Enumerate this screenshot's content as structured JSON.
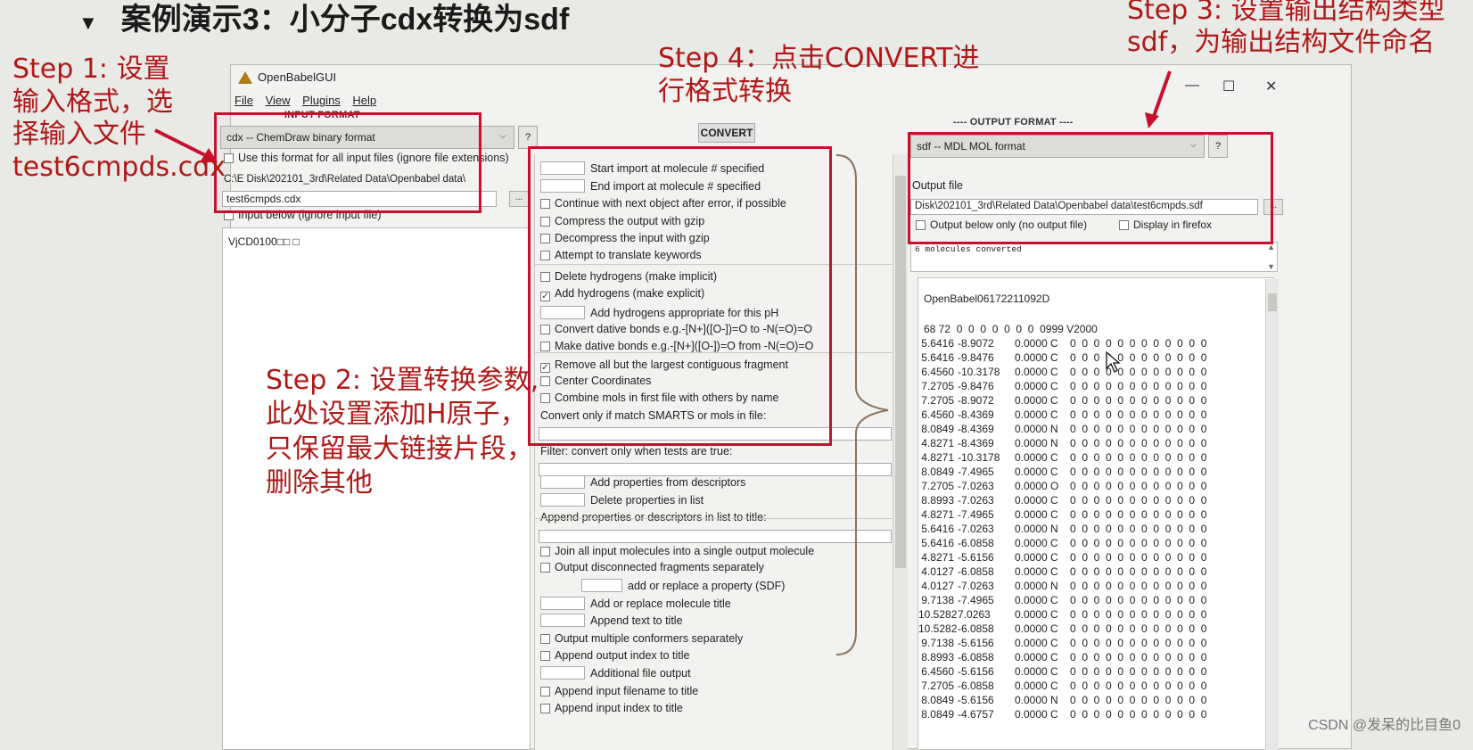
{
  "slide": {
    "bullet": "▼",
    "title": "案例演示3：小分子cdx转换为sdf",
    "step1": "Step 1: 设置输入格式，选择输入文件test6cmpds.cdx",
    "step2": "Step 2: 设置转换参数, 此处设置添加H原子，只保留最大链接片段，删除其他",
    "step3": "Step 3: 设置输出结构类型sdf，为输出结构文件命名",
    "step4": "Step 4：点击CONVERT进行格式转换",
    "watermark": "CSDN @发呆的比目鱼0",
    "annotation_color": "#c8102e"
  },
  "window": {
    "title": "OpenBabelGUI",
    "menu": [
      "File",
      "View",
      "Plugins",
      "Help"
    ],
    "controls": {
      "minimize": "—",
      "maximize": "☐",
      "close": "✕"
    }
  },
  "input": {
    "section_label": "INPUT FORMAT",
    "format": "cdx -- ChemDraw binary format",
    "help": "?",
    "use_for_all": "Use this format for all input files (ignore file extensions)",
    "folder": "C:\\E Disk\\202101_3rd\\Related Data\\Openbabel data\\",
    "file": "test6cmpds.cdx",
    "browse": "...",
    "input_below": "Input below (ignore input file)",
    "preview": "VjCD0100□□ □"
  },
  "convert_label": "CONVERT",
  "options": [
    {
      "type": "num",
      "label": "Start import at molecule # specified"
    },
    {
      "type": "num",
      "label": "End import at molecule # specified"
    },
    {
      "type": "check",
      "checked": false,
      "label": "Continue with next object after error, if possible"
    },
    {
      "type": "check",
      "checked": false,
      "label": "Compress the output with gzip"
    },
    {
      "type": "check",
      "checked": false,
      "label": "Decompress the input with gzip"
    },
    {
      "type": "check",
      "checked": false,
      "label": "Attempt to translate keywords"
    },
    {
      "type": "check",
      "checked": false,
      "label": "Delete hydrogens (make implicit)"
    },
    {
      "type": "check",
      "checked": true,
      "label": "Add hydrogens (make explicit)"
    },
    {
      "type": "num",
      "label": "Add hydrogens appropriate for this pH"
    },
    {
      "type": "check",
      "checked": false,
      "label": "Convert dative bonds e.g.-[N+]([O-])=O to -N(=O)=O"
    },
    {
      "type": "check",
      "checked": false,
      "label": "Make dative bonds e.g.-[N+]([O-])=O from -N(=O)=O"
    },
    {
      "type": "check",
      "checked": true,
      "label": "Remove all but the largest contiguous fragment"
    },
    {
      "type": "check",
      "checked": false,
      "label": "Center Coordinates"
    },
    {
      "type": "check",
      "checked": false,
      "label": "Combine mols in first file with others by name"
    },
    {
      "type": "label",
      "label": "Convert only if match SMARTS or mols in file:"
    },
    {
      "type": "field"
    },
    {
      "type": "label",
      "label": "Filter: convert only when tests are true:"
    },
    {
      "type": "field"
    },
    {
      "type": "num",
      "label": "Add properties from descriptors"
    },
    {
      "type": "num",
      "label": "Delete properties in list"
    },
    {
      "type": "label",
      "label": "Append properties or descriptors in list to title:"
    },
    {
      "type": "field"
    },
    {
      "type": "check",
      "checked": false,
      "label": "Join all input molecules into a single output molecule"
    },
    {
      "type": "check",
      "checked": false,
      "label": "Output disconnected fragments separately"
    },
    {
      "type": "num2",
      "label": "add or replace a property (SDF)"
    },
    {
      "type": "num",
      "label": "Add or replace molecule title"
    },
    {
      "type": "num",
      "label": "Append text to title"
    },
    {
      "type": "check",
      "checked": false,
      "label": "Output multiple conformers separately"
    },
    {
      "type": "check",
      "checked": false,
      "label": "Append output index to title"
    },
    {
      "type": "num",
      "label": "Additional file output"
    },
    {
      "type": "check",
      "checked": false,
      "label": "Append input filename to title"
    },
    {
      "type": "check",
      "checked": false,
      "label": "Append input index to title"
    }
  ],
  "output": {
    "section_label": "---- OUTPUT FORMAT ----",
    "format": "sdf -- MDL MOL format",
    "help": "?",
    "file_label": "Output file",
    "file": "Disk\\202101_3rd\\Related Data\\Openbabel data\\test6cmpds.sdf",
    "browse": "...",
    "below_only": "Output below only (no output file)",
    "display_firefox": "Display in firefox",
    "message": "6 molecules converted",
    "header": "OpenBabel06172211092D",
    "counts": "68 72  0  0  0  0  0  0  0  0999 V2000",
    "atoms": [
      [
        "5.6416",
        "-8.9072",
        "0.0000 C"
      ],
      [
        "5.6416",
        "-9.8476",
        "0.0000 C"
      ],
      [
        "6.4560",
        "-10.3178",
        "0.0000 C"
      ],
      [
        "7.2705",
        "-9.8476",
        "0.0000 C"
      ],
      [
        "7.2705",
        "-8.9072",
        "0.0000 C"
      ],
      [
        "6.4560",
        "-8.4369",
        "0.0000 C"
      ],
      [
        "8.0849",
        "-8.4369",
        "0.0000 N"
      ],
      [
        "4.8271",
        "-8.4369",
        "0.0000 N"
      ],
      [
        "4.8271",
        "-10.3178",
        "0.0000 C"
      ],
      [
        "8.0849",
        "-7.4965",
        "0.0000 C"
      ],
      [
        "7.2705",
        "-7.0263",
        "0.0000 O"
      ],
      [
        "8.8993",
        "-7.0263",
        "0.0000 C"
      ],
      [
        "4.8271",
        "-7.4965",
        "0.0000 C"
      ],
      [
        "5.6416",
        "-7.0263",
        "0.0000 N"
      ],
      [
        "5.6416",
        "-6.0858",
        "0.0000 C"
      ],
      [
        "4.8271",
        "-5.6156",
        "0.0000 C"
      ],
      [
        "4.0127",
        "-6.0858",
        "0.0000 C"
      ],
      [
        "4.0127",
        "-7.0263",
        "0.0000 N"
      ],
      [
        "9.7138",
        "-7.4965",
        "0.0000 C"
      ],
      [
        "10.5282",
        "7.0263",
        "0.0000 C"
      ],
      [
        "10.5282",
        "-6.0858",
        "0.0000 C"
      ],
      [
        "9.7138",
        "-5.6156",
        "0.0000 C"
      ],
      [
        "8.8993",
        "-6.0858",
        "0.0000 C"
      ],
      [
        "6.4560",
        "-5.6156",
        "0.0000 C"
      ],
      [
        "7.2705",
        "-6.0858",
        "0.0000 C"
      ],
      [
        "8.0849",
        "-5.6156",
        "0.0000 N"
      ],
      [
        "8.0849",
        "-4.6757",
        "0.0000 C"
      ]
    ],
    "flags": "0  0  0  0  0  0  0  0  0  0  0  0"
  }
}
